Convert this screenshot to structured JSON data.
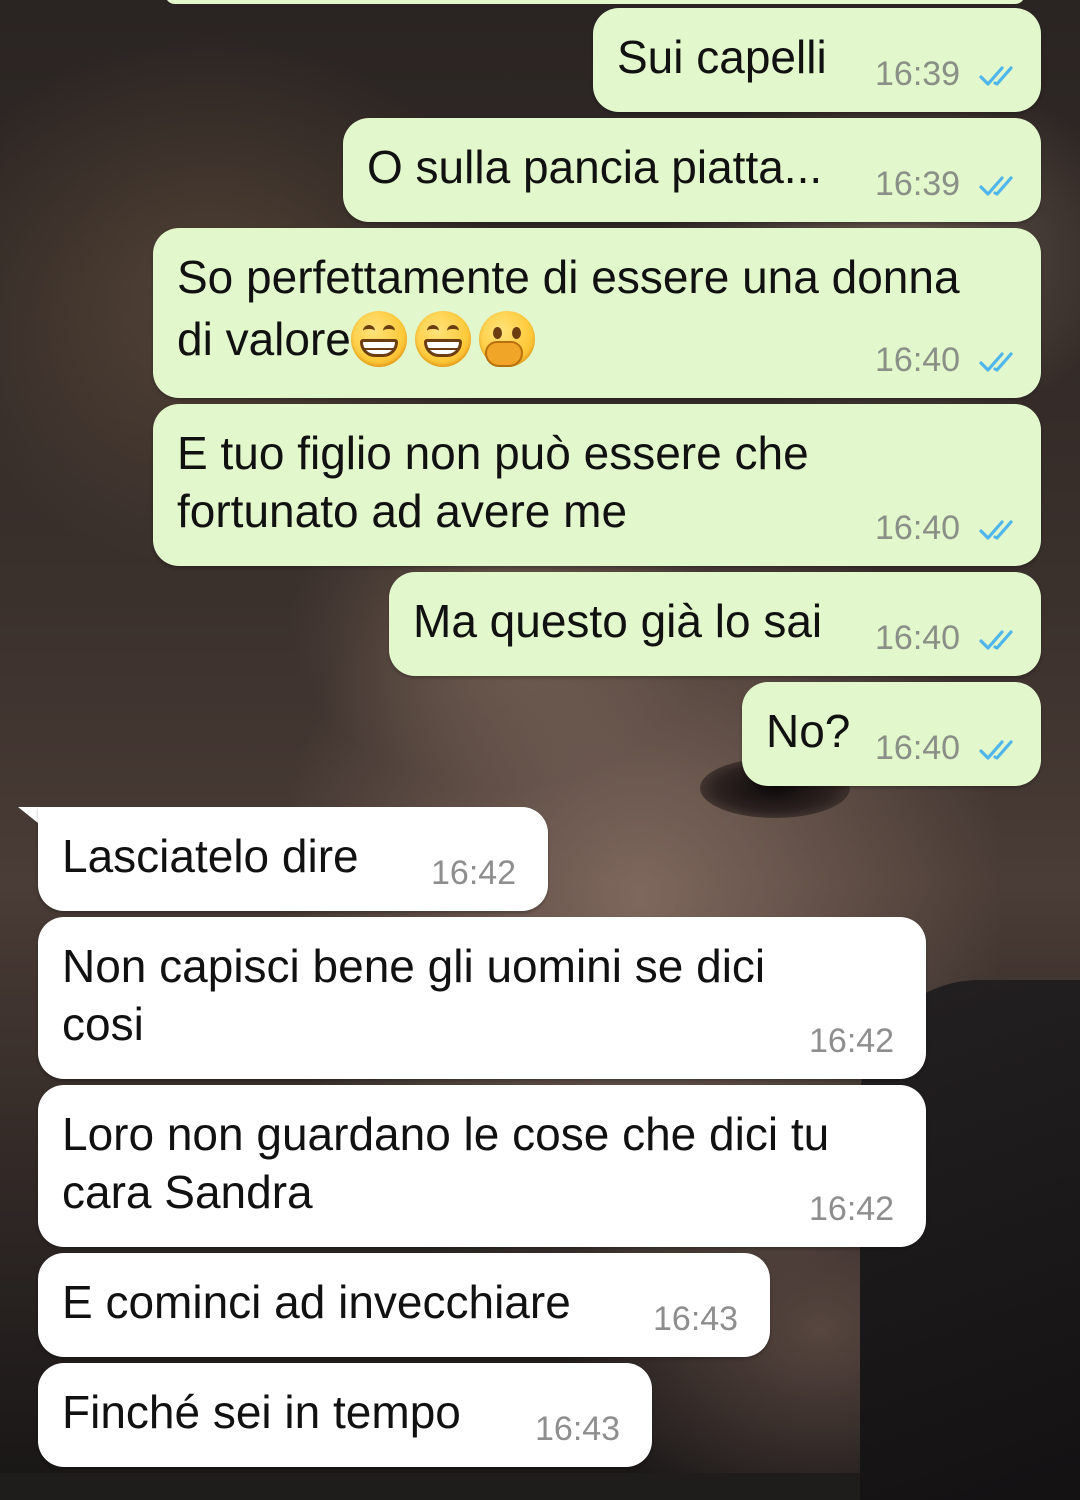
{
  "messages": [
    {
      "id": "m1",
      "direction": "out",
      "lines": [
        "Sui capelli"
      ],
      "time": "16:39",
      "status": "read"
    },
    {
      "id": "m2",
      "direction": "out",
      "lines": [
        "O sulla pancia piatta..."
      ],
      "time": "16:39",
      "status": "read"
    },
    {
      "id": "m3",
      "direction": "out",
      "lines": [
        "So perfettamente di essere una donna",
        "di valore"
      ],
      "emojis": [
        "grinning-face-with-smiling-eyes",
        "grinning-face-with-smiling-eyes",
        "face-with-hand-over-mouth"
      ],
      "time": "16:40",
      "status": "read"
    },
    {
      "id": "m4",
      "direction": "out",
      "lines": [
        "E tuo figlio non può essere che",
        "fortunato ad avere me"
      ],
      "time": "16:40",
      "status": "read"
    },
    {
      "id": "m5",
      "direction": "out",
      "lines": [
        "Ma questo già lo sai"
      ],
      "time": "16:40",
      "status": "read"
    },
    {
      "id": "m6",
      "direction": "out",
      "lines": [
        "No?"
      ],
      "time": "16:40",
      "status": "read"
    },
    {
      "id": "m7",
      "direction": "in",
      "lines": [
        "Lasciatelo dire"
      ],
      "time": "16:42"
    },
    {
      "id": "m8",
      "direction": "in",
      "lines": [
        "Non capisci bene gli uomini se dici",
        "cosi"
      ],
      "time": "16:42"
    },
    {
      "id": "m9",
      "direction": "in",
      "lines": [
        "Loro non guardano le cose che dici tu",
        "cara Sandra"
      ],
      "time": "16:42"
    },
    {
      "id": "m10",
      "direction": "in",
      "lines": [
        "E cominci ad invecchiare"
      ],
      "time": "16:43"
    },
    {
      "id": "m11",
      "direction": "in",
      "lines": [
        "Finché sei in tempo"
      ],
      "time": "16:43"
    }
  ],
  "colors": {
    "outgoing_bubble": "#e2f7cb",
    "incoming_bubble": "#ffffff",
    "read_ticks": "#4fb6ec",
    "timestamp": "#8a8f87"
  },
  "icons": {
    "read_receipt": "double-check-icon"
  }
}
